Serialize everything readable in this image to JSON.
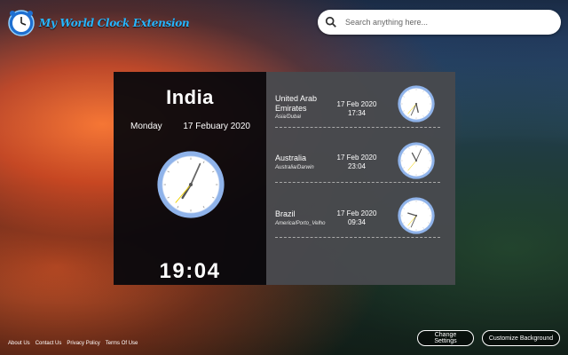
{
  "app": {
    "logo_text": "My World Clock Extension"
  },
  "search": {
    "placeholder": "Search anything here..."
  },
  "main_clock": {
    "country": "India",
    "day": "Monday",
    "date": "17 Febuary 2020",
    "time": "19:04",
    "hour": 7,
    "minute": 4,
    "second": 20
  },
  "world_clocks": [
    {
      "city": "United Arab Emirates",
      "city_line1": "United Arab",
      "city_line2": "Emirates",
      "timezone": "Asia/Dubai",
      "date": "17 Feb 2020",
      "time": "17:34",
      "hour": 5,
      "minute": 34,
      "second": 20
    },
    {
      "city": "Australia",
      "city_line1": "Australia",
      "city_line2": "",
      "timezone": "Australia/Darwin",
      "date": "17 Feb 2020",
      "time": "23:04",
      "hour": 11,
      "minute": 4,
      "second": 20
    },
    {
      "city": "Brazil",
      "city_line1": "Brazil",
      "city_line2": "",
      "timezone": "America/Porto_Velho",
      "date": "17 Feb 2020",
      "time": "09:34",
      "hour": 9,
      "minute": 34,
      "second": 20
    }
  ],
  "footer": {
    "links": [
      "About Us",
      "Contact Us",
      "Privacy Policy",
      "Terms Of Use"
    ],
    "change_settings": "Change Settings",
    "customize_background": "Customize Background"
  },
  "colors": {
    "accent": "#27b6ff",
    "clock_ring": "#8fb3ea",
    "second_hand": "#f2d200"
  }
}
